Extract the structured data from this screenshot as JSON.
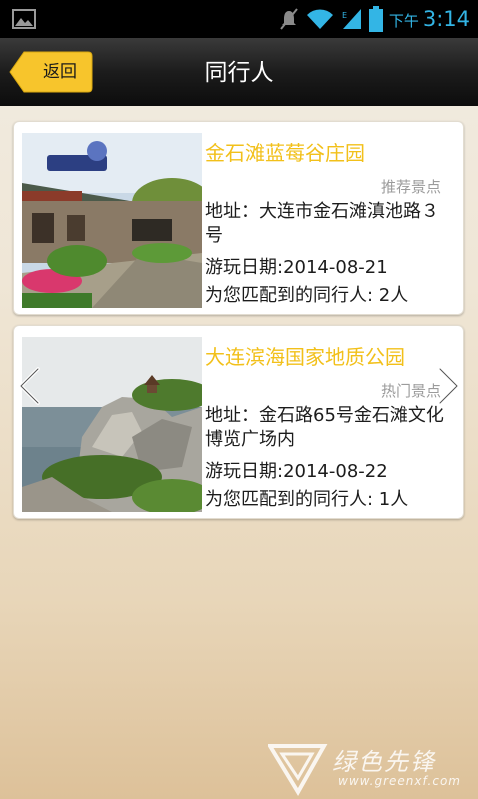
{
  "status_bar": {
    "ampm": "下午",
    "time": "3:14",
    "color": "#33b5e5"
  },
  "nav": {
    "back_label": "返回",
    "title": "同行人",
    "accent": "#f7c52c"
  },
  "cards": [
    {
      "name": "金石滩蓝莓谷庄园",
      "tag": "推荐景点",
      "address": "地址：大连市金石滩滇池路３号",
      "date": "游玩日期:2014-08-21",
      "match": "为您匹配到的同行人: 2人"
    },
    {
      "name": "大连滨海国家地质公园",
      "tag": "热门景点",
      "address": "地址：金石路65号金石滩文化博览广场内",
      "date": "游玩日期:2014-08-22",
      "match": "为您匹配到的同行人: 1人"
    }
  ],
  "watermark": {
    "brand": "绿色先锋",
    "url": "www.greenxf.com"
  },
  "icons": {
    "gallery": "image-icon",
    "mute": "mute-icon",
    "wifi": "wifi-icon",
    "signal": "signal-icon",
    "battery": "battery-icon",
    "prev": "chevron-left-icon",
    "next": "chevron-right-icon"
  }
}
